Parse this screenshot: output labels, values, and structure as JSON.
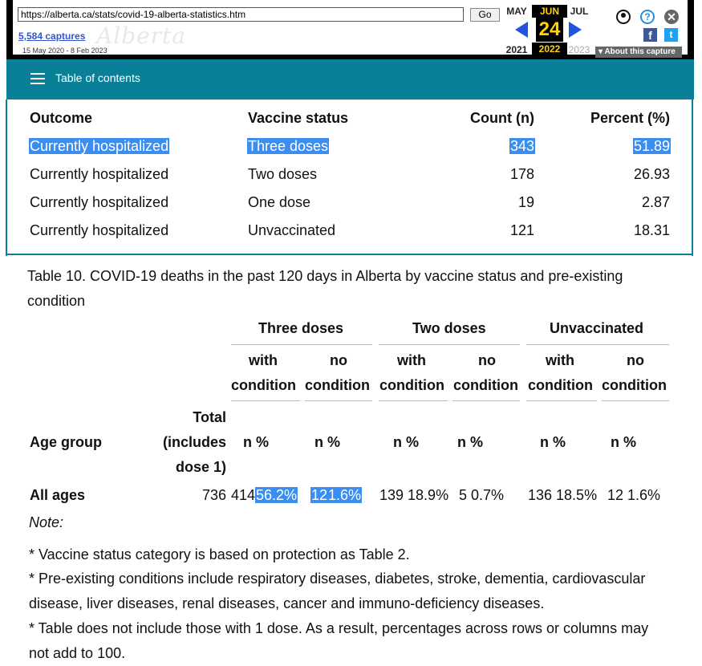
{
  "wayback": {
    "url": "https://alberta.ca/stats/covid-19-alberta-statistics.htm",
    "go": "Go",
    "captures": "5,584 captures",
    "range": "15 May 2020 - 8 Feb 2023",
    "watermark": "Alberta",
    "months": [
      "MAY",
      "JUN",
      "JUL"
    ],
    "day": "24",
    "years": [
      "2021",
      "2022",
      "2023"
    ],
    "help_glyph": "?",
    "close_glyph": "✕",
    "fb_glyph": "f",
    "tw_glyph": "t",
    "about": "About this capture"
  },
  "toc": {
    "label": "Table of contents"
  },
  "table9": {
    "headers": [
      "Outcome",
      "Vaccine status",
      "Count (n)",
      "Percent (%)"
    ],
    "rows": [
      [
        "Currently hospitalized",
        "Three doses",
        "343",
        "51.89"
      ],
      [
        "Currently hospitalized",
        "Two doses",
        "178",
        "26.93"
      ],
      [
        "Currently hospitalized",
        "One dose",
        "19",
        "2.87"
      ],
      [
        "Currently hospitalized",
        "Unvaccinated",
        "121",
        "18.31"
      ]
    ]
  },
  "table10": {
    "caption": "Table 10. COVID-19 deaths in the past 120 days in Alberta by vaccine status and pre-existing condition",
    "groups": [
      "Three doses",
      "Two doses",
      "Unvaccinated"
    ],
    "sub_with": [
      "with",
      "condition"
    ],
    "sub_no": [
      "no",
      "condition"
    ],
    "age_group": "Age group",
    "total": [
      "Total",
      "(includes",
      "dose 1)"
    ],
    "n_pct": "n %",
    "row": {
      "label": "All ages",
      "total": "736",
      "three_with_n": "414",
      "three_with_pct": "56.2%",
      "three_no_n": "12",
      "three_no_pct": "1.6%",
      "two_with": "139 18.9%",
      "two_no": "5 0.7%",
      "unvax_with": "136 18.5%",
      "unvax_no": "12 1.6%"
    }
  },
  "notes": {
    "label": "Note:",
    "items": [
      "* Vaccine status category is based on protection as Table 2.",
      "* Pre-existing conditions include respiratory diseases, diabetes, stroke, dementia, cardiovascular disease, liver diseases, renal diseases, cancer and immuno-deficiency diseases.",
      "* Table does not include those with 1 dose. As a result, percentages across rows or columns may not add to 100."
    ]
  }
}
